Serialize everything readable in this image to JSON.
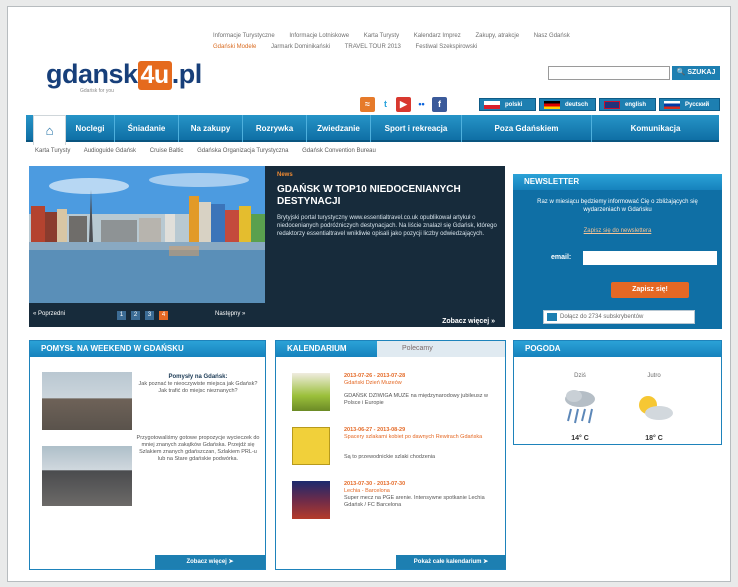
{
  "top_links": [
    "Informacje Turystyczne",
    "Informacje Lotniskowe",
    "Karta Turysty",
    "Kalendarz Imprez",
    "Zakupy, atrakcje",
    "Nasz Gdańsk",
    "Gdański Modele",
    "Jarmark Dominikański",
    "TRAVEL TOUR 2013",
    "Festiwal Szekspirowski"
  ],
  "logo": {
    "part1": "gdansk",
    "part2": "4u",
    "part3": ".pl",
    "tagline": "Gdańsk for you"
  },
  "search": {
    "placeholder": "",
    "button": "SZUKAJ"
  },
  "languages": [
    "polski",
    "deutsch",
    "english",
    "Pусский"
  ],
  "nav": [
    "Noclegi",
    "Śniadanie",
    "Na zakupy",
    "Rozrywka",
    "Zwiedzanie",
    "Sport i rekreacja",
    "Poza Gdańskiem",
    "Komunikacja"
  ],
  "subnav": [
    "Karta Turysty",
    "Audioguide Gdańsk",
    "Cruise Baltic",
    "Gdańska Organizacja Turystyczna",
    "Gdańsk Convention Bureau"
  ],
  "slider": {
    "tag": "News",
    "title": "GDAŃSK W TOP10 NIEDOCENIANYCH DESTYNACJI",
    "body": "Brytyjski portal turystyczny www.essentialtravel.co.uk opublikował artykuł o niedocenianych podróżniczych destynacjach. Na liście znalazł się Gdańsk, którego redaktorzy essentialtravel wnikliwie opisali jako pozycji liczby odwiedzających.",
    "more": "Zobacz więcej »",
    "prev": "« Poprzedni",
    "next": "Następny »",
    "pages": [
      "1",
      "2",
      "3",
      "4"
    ]
  },
  "newsletter": {
    "title": "NEWSLETTER",
    "body": "Raz w miesiącu będziemy informować Cię o zbliżających się wydarzeniach w Gdańsku",
    "link": "Zapisz się do newslettera",
    "email_label": "email:",
    "submit": "Zapisz się!",
    "count": "Dołącz do 2734 subskrybentów"
  },
  "weekend": {
    "title": "POMYSŁ NA WEEKEND W GDAŃSKU",
    "item1_title": "Pomysły na Gdańsk:",
    "item1_body": "Jak poznać te nieoczywiste miejsca jak Gdańsk? Jak trafić do miejsc nieznanych?",
    "item2_body": "Przygotowaliśmy gotowe propozycje wycieczek do mniej znanych zakątków Gdańska. Przejdź się Szlakiem znanych gdańszczan, Szlakiem PRL-u lub na Stare gdańskie podwórka.",
    "more": "Zobacz więcej"
  },
  "calendar": {
    "title": "KALENDARIUM",
    "tab2": "Polecamy",
    "events": [
      {
        "date": "2013-07-26 - 2013-07-28",
        "title": "Gdański Dzień Muzeów",
        "desc": "GDAŃSK DZIWIGA MUZE na międzynarodowy jubileusz w Polsce i Europie"
      },
      {
        "date": "2013-06-27 - 2013-08-29",
        "title": "Spacery szlakami kobiet po dawnych Rewirach Gdańska",
        "desc": "Są to przewodnickie szlaki chodzenia"
      },
      {
        "date": "2013-07-30 - 2013-07-30",
        "title": "Lechia - Barcelona",
        "desc": "Super mecz na PGE arenie. Intensywne spotkanie Lechia Gdańsk / FC Barcelona"
      }
    ],
    "more": "Pokaż całe kalendarium"
  },
  "weather": {
    "title": "POGODA",
    "days": [
      {
        "label": "Dziś",
        "temp": "14° C",
        "icon": "rain-icon"
      },
      {
        "label": "Jutro",
        "temp": "18° C",
        "icon": "sun-cloud-icon"
      }
    ]
  },
  "colors": {
    "brand_blue": "#1d7fb1",
    "accent_orange": "#e46824",
    "navy": "#173f7a"
  }
}
